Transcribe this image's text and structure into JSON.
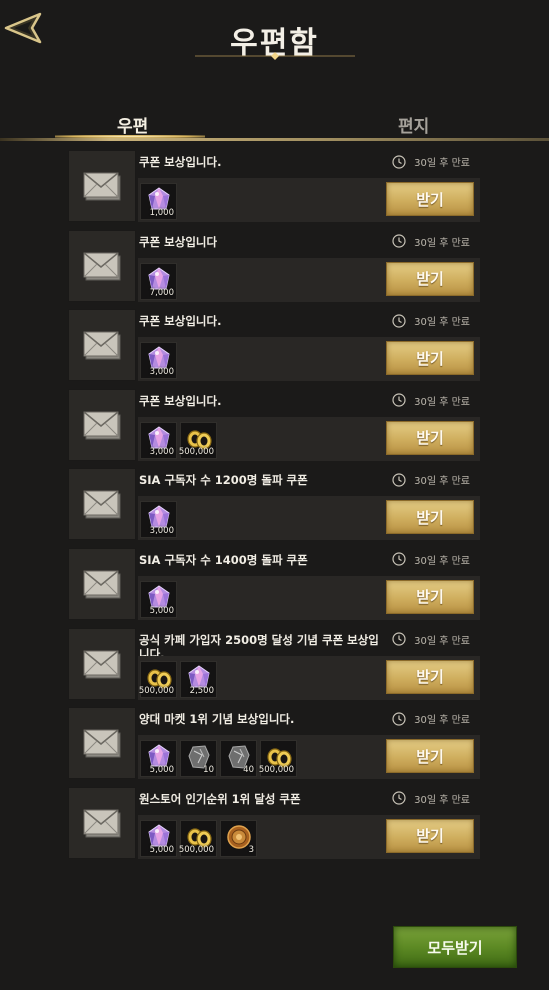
{
  "header": {
    "title": "우편함"
  },
  "tabs": [
    {
      "label": "우편"
    },
    {
      "label": "편지"
    }
  ],
  "mails": [
    {
      "title": "쿠폰 보상입니다.",
      "expire": "30일 후 만료",
      "claim": "받기",
      "rewards": [
        {
          "icon": "gem-icon",
          "qty": "1,000"
        }
      ]
    },
    {
      "title": "쿠폰 보상입니다",
      "expire": "30일 후 만료",
      "claim": "받기",
      "rewards": [
        {
          "icon": "gem-icon",
          "qty": "7,000"
        }
      ]
    },
    {
      "title": "쿠폰 보상입니다.",
      "expire": "30일 후 만료",
      "claim": "받기",
      "rewards": [
        {
          "icon": "gem-icon",
          "qty": "3,000"
        }
      ]
    },
    {
      "title": "쿠폰 보상입니다.",
      "expire": "30일 후 만료",
      "claim": "받기",
      "rewards": [
        {
          "icon": "gem-icon",
          "qty": "3,000"
        },
        {
          "icon": "gold-coin-icon",
          "qty": "500,000"
        }
      ]
    },
    {
      "title": "SIA 구독자 수 1200명 돌파 쿠폰",
      "expire": "30일 후 만료",
      "claim": "받기",
      "rewards": [
        {
          "icon": "gem-icon",
          "qty": "3,000"
        }
      ]
    },
    {
      "title": "SIA 구독자 수 1400명 돌파 쿠폰",
      "expire": "30일 후 만료",
      "claim": "받기",
      "rewards": [
        {
          "icon": "gem-icon",
          "qty": "5,000"
        }
      ]
    },
    {
      "title": "공식 카페 가입자 2500명 달성 기념 쿠폰 보상입니다.",
      "expire": "30일 후 만료",
      "claim": "받기",
      "rewards": [
        {
          "icon": "gold-coin-icon",
          "qty": "500,000"
        },
        {
          "icon": "gem-icon",
          "qty": "2,500"
        }
      ]
    },
    {
      "title": "양대 마켓 1위 기념 보상입니다.",
      "expire": "30일 후 만료",
      "claim": "받기",
      "rewards": [
        {
          "icon": "gem-icon",
          "qty": "5,000"
        },
        {
          "icon": "stone-icon",
          "qty": "10"
        },
        {
          "icon": "stone-icon",
          "qty": "40"
        },
        {
          "icon": "gold-coin-icon",
          "qty": "500,000"
        }
      ]
    },
    {
      "title": "원스토어 인기순위 1위 달성 쿠폰",
      "expire": "30일 후 만료",
      "claim": "받기",
      "rewards": [
        {
          "icon": "gem-icon",
          "qty": "5,000"
        },
        {
          "icon": "gold-coin-icon",
          "qty": "500,000"
        },
        {
          "icon": "medal-icon",
          "qty": "3"
        }
      ]
    }
  ],
  "footer": {
    "claim_all": "모두받기"
  },
  "colors": {
    "gold": "#d7b865",
    "green": "#5d8a24",
    "background": "#1b1a19"
  }
}
